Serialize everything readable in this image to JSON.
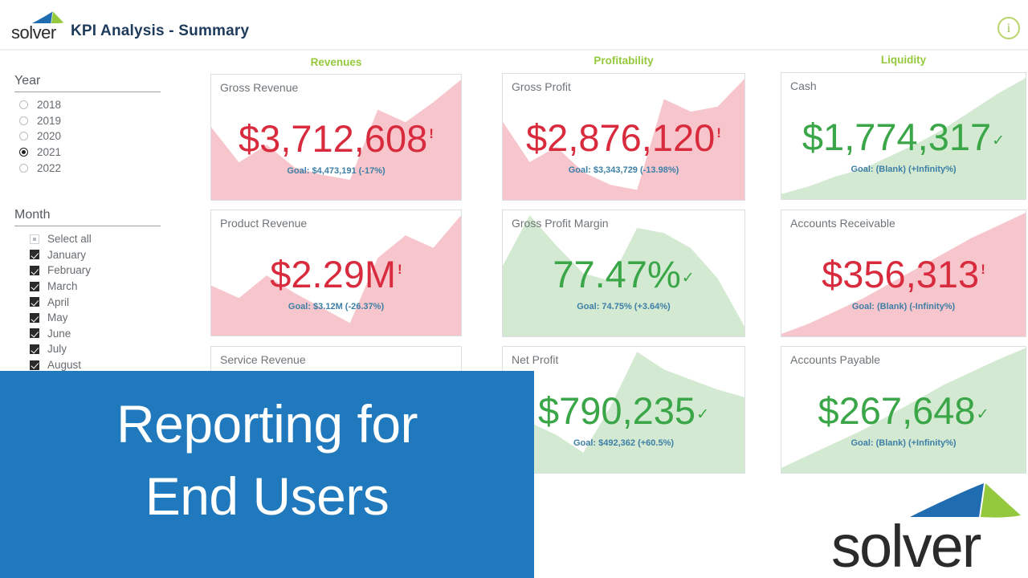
{
  "header": {
    "brand_word": "solver",
    "brand_mark": "solver-triangle-logo",
    "title": "KPI Analysis - Summary",
    "info_icon_label": "i"
  },
  "slicers": {
    "year": {
      "title": "Year",
      "options": [
        {
          "label": "2018",
          "selected": false
        },
        {
          "label": "2019",
          "selected": false
        },
        {
          "label": "2020",
          "selected": false
        },
        {
          "label": "2021",
          "selected": true
        },
        {
          "label": "2022",
          "selected": false
        }
      ]
    },
    "month": {
      "title": "Month",
      "select_all_label": "Select all",
      "select_all_state": "partial",
      "options": [
        {
          "label": "January",
          "checked": true
        },
        {
          "label": "February",
          "checked": true
        },
        {
          "label": "March",
          "checked": true
        },
        {
          "label": "April",
          "checked": true
        },
        {
          "label": "May",
          "checked": true
        },
        {
          "label": "June",
          "checked": true
        },
        {
          "label": "July",
          "checked": true
        },
        {
          "label": "August",
          "checked": true
        }
      ]
    }
  },
  "columns": [
    {
      "label": "Revenues"
    },
    {
      "label": "Profitability"
    },
    {
      "label": "Liquidity"
    }
  ],
  "colors": {
    "accent_green": "#95c93d",
    "bad_red": "#d92b3e",
    "good_green": "#3aa648",
    "goal_blue": "#3d7fa6",
    "banner_blue": "#2079bd",
    "title_navy": "#1f3b5c",
    "area_red": "#f7c6cc",
    "area_green": "#d3e9d1"
  },
  "chart_data": {
    "type": "table",
    "title": "KPI Analysis - Summary",
    "cards": [
      {
        "name": "Gross Revenue",
        "value": "$3,712,608",
        "goal": "Goal: $4,473,191 (-17%)",
        "status": "bad",
        "flag": "!",
        "goal_value": 4473191,
        "actual_value": 3712608,
        "variance_pct": -17,
        "sparkline": [
          58,
          30,
          44,
          26,
          20,
          16,
          72,
          62,
          78,
          96
        ]
      },
      {
        "name": "Product Revenue",
        "value": "$2.29M",
        "goal": "Goal: $3.12M (-26.37%)",
        "status": "bad",
        "flag": "!",
        "goal_value": 3120000,
        "actual_value": 2290000,
        "variance_pct": -26.37,
        "sparkline": [
          40,
          30,
          48,
          34,
          22,
          10,
          62,
          80,
          70,
          96
        ]
      },
      {
        "name": "Service Revenue",
        "value": "",
        "goal": "",
        "status": "bad",
        "flag": "",
        "sparkline": []
      },
      {
        "name": "Gross Profit",
        "value": "$2,876,120",
        "goal": "Goal: $3,343,729 (-13.98%)",
        "status": "bad",
        "flag": "!",
        "goal_value": 3343729,
        "actual_value": 2876120,
        "variance_pct": -13.98,
        "sparkline": [
          62,
          30,
          42,
          22,
          12,
          8,
          80,
          70,
          74,
          96
        ]
      },
      {
        "name": "Gross Profit Margin",
        "value": "77.47%",
        "goal": "Goal: 74.75% (+3.64%)",
        "status": "good",
        "flag": "✓",
        "goal_value": 74.75,
        "actual_value": 77.47,
        "variance_pct": 3.64,
        "sparkline": [
          56,
          96,
          72,
          50,
          44,
          86,
          82,
          70,
          46,
          8
        ]
      },
      {
        "name": "Net Profit",
        "value": "$790,235",
        "goal": "Goal: $492,362 (+60.5%)",
        "status": "good",
        "flag": "✓",
        "goal_value": 492362,
        "actual_value": 790235,
        "variance_pct": 60.5,
        "sparkline": [
          26,
          40,
          30,
          16,
          52,
          96,
          82,
          74,
          66,
          60
        ]
      },
      {
        "name": "Cash",
        "value": "$1,774,317",
        "goal": "Goal: (Blank) (+Infinity%)",
        "status": "good",
        "flag": "✓",
        "actual_value": 1774317,
        "sparkline": [
          4,
          10,
          18,
          24,
          34,
          44,
          56,
          70,
          84,
          96
        ]
      },
      {
        "name": "Accounts Receivable",
        "value": "$356,313",
        "goal": "Goal: (Blank) (-Infinity%)",
        "status": "bad",
        "flag": "!",
        "actual_value": 356313,
        "sparkline": [
          2,
          10,
          20,
          30,
          42,
          54,
          66,
          78,
          88,
          98
        ]
      },
      {
        "name": "Accounts Payable",
        "value": "$267,648",
        "goal": "Goal: (Blank) (+Infinity%)",
        "status": "good",
        "flag": "✓",
        "actual_value": 267648,
        "sparkline": [
          4,
          14,
          24,
          34,
          46,
          58,
          70,
          80,
          90,
          99
        ]
      }
    ]
  },
  "banner": {
    "line1": "Reporting for",
    "line2": "End Users"
  },
  "footer_logo": {
    "word": "solver",
    "mark": "solver-triangle-logo"
  }
}
